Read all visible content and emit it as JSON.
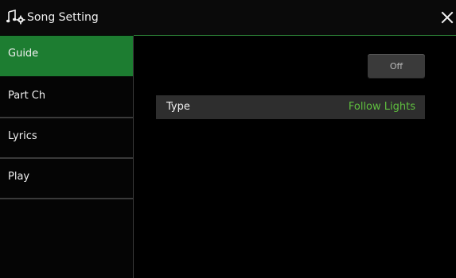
{
  "window": {
    "title": "Song Setting",
    "title_icon": "note-gear-icon",
    "close_icon": "close-icon"
  },
  "sidebar": {
    "active_index": 0,
    "items": [
      {
        "label": "Guide"
      },
      {
        "label": "Part Ch"
      },
      {
        "label": "Lyrics"
      },
      {
        "label": "Play"
      }
    ]
  },
  "guide": {
    "toggle_label": "Off",
    "type_label": "Type",
    "type_value": "Follow Lights"
  },
  "colors": {
    "accent_green": "#1d7d31",
    "value_green": "#5fbf3f",
    "background": "#000000"
  }
}
